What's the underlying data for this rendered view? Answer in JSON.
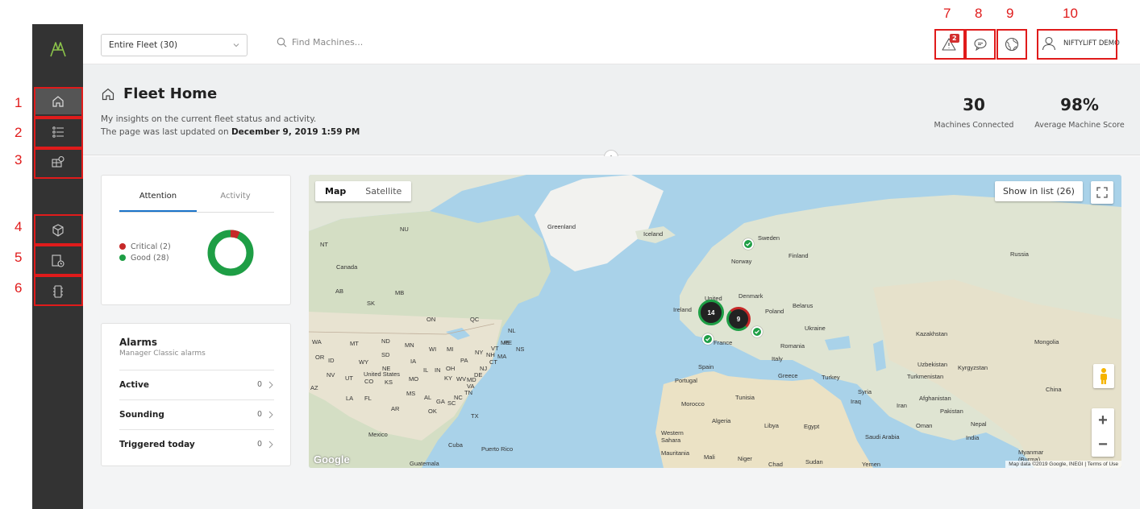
{
  "annotations": [
    "1",
    "2",
    "3",
    "4",
    "5",
    "6",
    "7",
    "8",
    "9",
    "10"
  ],
  "topbar": {
    "fleet_select": "Entire Fleet (30)",
    "search_placeholder": "Find Machines...",
    "alerts_badge": "2",
    "user_name": "NIFTYLIFT DEMO"
  },
  "header": {
    "title": "Fleet Home",
    "subtitle_line1": "My insights on the current fleet status and activity.",
    "subtitle_line2_prefix": "The page was last updated on ",
    "updated": "December 9, 2019 1:59 PM",
    "stats": [
      {
        "value": "30",
        "label": "Machines Connected"
      },
      {
        "value": "98%",
        "label": "Average Machine Score"
      }
    ]
  },
  "attention": {
    "tabs": [
      "Attention",
      "Activity"
    ],
    "legend": [
      {
        "label": "Critical (2)",
        "color": "#c62828",
        "count": 2
      },
      {
        "label": "Good (28)",
        "color": "#1e9e45",
        "count": 28
      }
    ]
  },
  "alarms": {
    "title": "Alarms",
    "subtitle": "Manager Classic alarms",
    "rows": [
      {
        "label": "Active",
        "count": "0"
      },
      {
        "label": "Sounding",
        "count": "0"
      },
      {
        "label": "Triggered today",
        "count": "0"
      }
    ]
  },
  "map": {
    "type_options": [
      "Map",
      "Satellite"
    ],
    "show_list": "Show in list (26)",
    "clusters": [
      "14",
      "9"
    ],
    "labels": [
      "Greenland",
      "Iceland",
      "Sweden",
      "Finland",
      "Norway",
      "Russia",
      "Canada",
      "United",
      "Ireland",
      "Denmark",
      "Poland",
      "Belarus",
      "Ukraine",
      "France",
      "Romania",
      "Kazakhstan",
      "Mongolia",
      "Italy",
      "Spain",
      "Portugal",
      "Greece",
      "Turkey",
      "Uzbekistan",
      "Kyrgyzstan",
      "Turkmenistan",
      "China",
      "Syria",
      "Iraq",
      "Iran",
      "Afghanistan",
      "Pakistan",
      "Nepal",
      "India",
      "Myanmar (Burma)",
      "Morocco",
      "Tunisia",
      "Algeria",
      "Libya",
      "Egypt",
      "Saudi Arabia",
      "Oman",
      "Western Sahara",
      "Mauritania",
      "Mali",
      "Niger",
      "Chad",
      "Sudan",
      "Yemen",
      "United States",
      "Mexico",
      "Cuba",
      "Puerto Rico",
      "Guatemala",
      "NU",
      "NT",
      "AB",
      "SK",
      "MB",
      "ON",
      "QC",
      "NL",
      "PE",
      "NS",
      "WA",
      "MT",
      "ND",
      "MN",
      "WI",
      "MI",
      "OR",
      "ID",
      "WY",
      "SD",
      "IA",
      "NE",
      "NV",
      "UT",
      "CO",
      "KS",
      "MO",
      "IL",
      "IN",
      "OH",
      "PA",
      "NY",
      "VT",
      "ME",
      "NH",
      "MA",
      "CT",
      "NJ",
      "DE",
      "MD",
      "VA",
      "WV",
      "KY",
      "TN",
      "NC",
      "SC",
      "GA",
      "AL",
      "MS",
      "AR",
      "OK",
      "TX",
      "LA",
      "FL",
      "AZ",
      "NM",
      "CA"
    ],
    "google": "Google",
    "attribution": "Map data ©2019 Google, INEGI | Terms of Use"
  }
}
